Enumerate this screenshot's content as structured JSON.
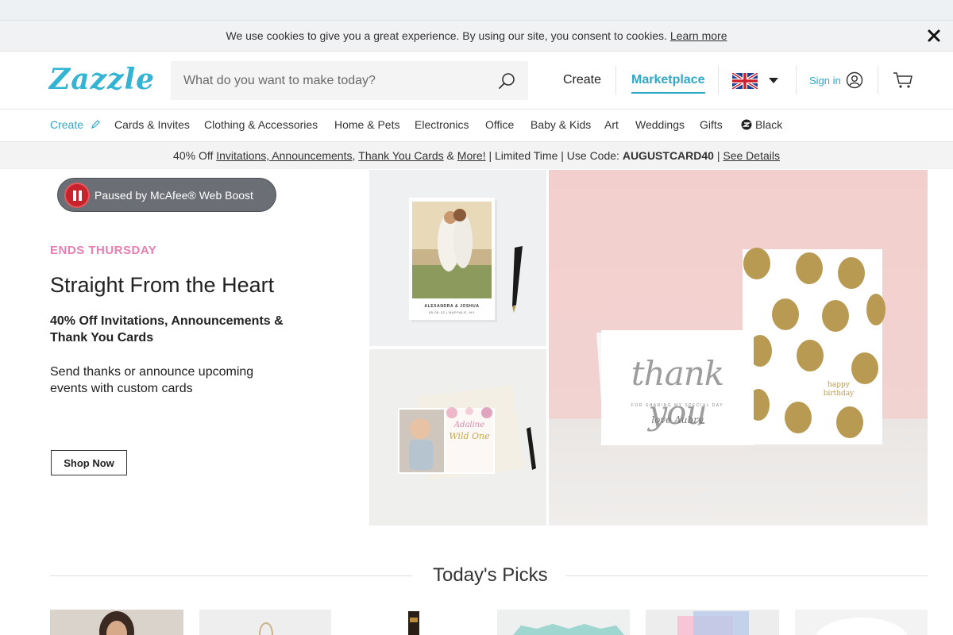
{
  "cookie_bar": {
    "message": "We use cookies to give you a great experience. By using our site, you consent to cookies.",
    "link": "Learn more",
    "close_icon": "close-icon"
  },
  "header": {
    "logo": "Zazzle",
    "search_placeholder": "What do you want to make today?",
    "create": "Create",
    "marketplace": "Marketplace",
    "region_icon": "uk-flag-icon",
    "signin": "Sign in",
    "accent": "#2fa7c8",
    "logo_color": "#34b4d3"
  },
  "categories": {
    "create": "Create",
    "items": [
      "Cards & Invites",
      "Clothing & Accessories",
      "Home & Pets",
      "Electronics",
      "Office",
      "Baby & Kids",
      "Art",
      "Weddings",
      "Gifts"
    ],
    "black": "Black"
  },
  "promo": {
    "prefix": "40% Off ",
    "link1": "Invitations, Announcements",
    "sep1": ", ",
    "link2": "Thank You Cards",
    "amp": " & ",
    "link3": "More!",
    "mid": " | Limited Time | Use Code: ",
    "code": "AUGUSTCARD40",
    "sep2": " | ",
    "details": "See Details"
  },
  "mcafee": {
    "text": "Paused by McAfee® Web Boost"
  },
  "hero": {
    "eyebrow": "ENDS THURSDAY",
    "title": "Straight From the Heart",
    "subtitle": "40% Off Invitations, Announcements & Thank You Cards",
    "description": "Send thanks or announce upcoming events with custom cards",
    "cta": "Shop Now",
    "eyebrow_color": "#e87fb0",
    "images": {
      "save_the_date_names": "ALEXANDRA & JOSHUA",
      "save_the_date_place": "05.05.22 | BUFFALO, NY",
      "birth_card_name": "Adaline",
      "birth_card_title": "Wild One",
      "thank_you_script": "thank you",
      "thank_you_line": "FOR SHARING MY SPECIAL DAY",
      "thank_you_sign": "love Aubry",
      "birthday_text_1": "happy",
      "birthday_text_2": "birthday"
    }
  },
  "picks": {
    "title": "Today's Picks"
  }
}
